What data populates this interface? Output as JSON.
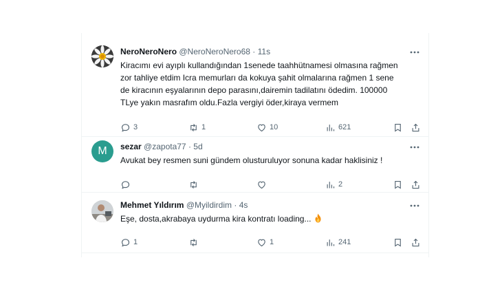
{
  "tweets": [
    {
      "display_name": "NeroNeroNero",
      "handle": "@NeroNeroNero68",
      "time": "11s",
      "avatar_icon": "daisy-avatar-icon",
      "text_lines": [
        "Kiracımı evi ayıplı kullandığından 1senede taahhütnamesi olmasına rağmen",
        "zor tahliye etdim Icra memurları da kokuya şahit olmalarına rağmen 1 sene",
        "de kiracının eşyalarının depo parasını,dairemin tadilatını ödedim. 100000",
        "TLye yakın masrafım oldu.Fazla vergiyi öder,kiraya vermem"
      ],
      "replies": "3",
      "reposts": "1",
      "likes": "10",
      "views": "621"
    },
    {
      "display_name": "sezar",
      "handle": "@zapota77",
      "time": "5d",
      "avatar_letter": "M",
      "text_lines": [
        "Avukat bey resmen suni gündem olusturuluyor sonuna kadar haklisiniz !"
      ],
      "replies": "",
      "reposts": "",
      "likes": "",
      "views": "2"
    },
    {
      "display_name": "Mehmet Yıldırım",
      "handle": "@Myildirdim",
      "time": "4s",
      "avatar_icon": "person-photo-avatar-icon",
      "text_lines": [
        "Eşe, dosta,akrabaya uydurma kira kontratı loading..."
      ],
      "emoji": "fire-emoji-icon",
      "replies": "1",
      "reposts": "",
      "likes": "1",
      "views": "241"
    }
  ],
  "separator": "·",
  "colors": {
    "text": "#0f1419",
    "secondary": "#536471",
    "border": "#eff3f4",
    "avatar_m": "#2a9d8f"
  }
}
